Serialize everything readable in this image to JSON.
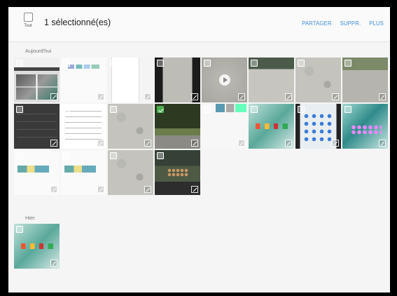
{
  "header": {
    "select_all_label": "Tout",
    "selected_count": "1 sélectionné(es)",
    "actions": [
      {
        "label": "PARTAGER"
      },
      {
        "label": "SUPPR."
      },
      {
        "label": "PLUS"
      }
    ]
  },
  "sections": {
    "today": {
      "label": "Aujourd'hui",
      "items": [
        {
          "style": "t-screens",
          "checked": false,
          "video": false
        },
        {
          "style": "t-white",
          "checked": false,
          "video": false
        },
        {
          "style": "t-phone",
          "checked": false,
          "video": false
        },
        {
          "style": "t-gravel-dark",
          "checked": false,
          "video": false
        },
        {
          "style": "t-video",
          "checked": false,
          "video": true
        },
        {
          "style": "t-park",
          "checked": false,
          "video": false
        },
        {
          "style": "t-gravel",
          "checked": false,
          "video": false
        },
        {
          "style": "t-park2",
          "checked": false,
          "video": false
        },
        {
          "style": "t-settings",
          "checked": false,
          "video": false
        },
        {
          "style": "t-list",
          "checked": false,
          "video": false
        },
        {
          "style": "t-gravel",
          "checked": false,
          "video": false
        },
        {
          "style": "t-trees",
          "checked": true,
          "video": false
        },
        {
          "style": "t-strip",
          "checked": false,
          "video": false
        },
        {
          "style": "t-tablet",
          "checked": false,
          "video": false
        },
        {
          "style": "t-tabletdark",
          "checked": false,
          "video": false
        },
        {
          "style": "t-tablet2",
          "checked": false,
          "video": false
        },
        {
          "style": "t-banner",
          "checked": false,
          "video": false
        },
        {
          "style": "t-banner",
          "checked": false,
          "video": false
        },
        {
          "style": "t-gravel",
          "checked": false,
          "video": false
        },
        {
          "style": "t-dusk",
          "checked": false,
          "video": false
        }
      ]
    },
    "yesterday": {
      "label": "Hier",
      "items": [
        {
          "style": "t-tablet",
          "checked": false,
          "video": false
        }
      ]
    }
  },
  "colors": {
    "accent": "#3f8fd8",
    "check": "#4caf50"
  }
}
